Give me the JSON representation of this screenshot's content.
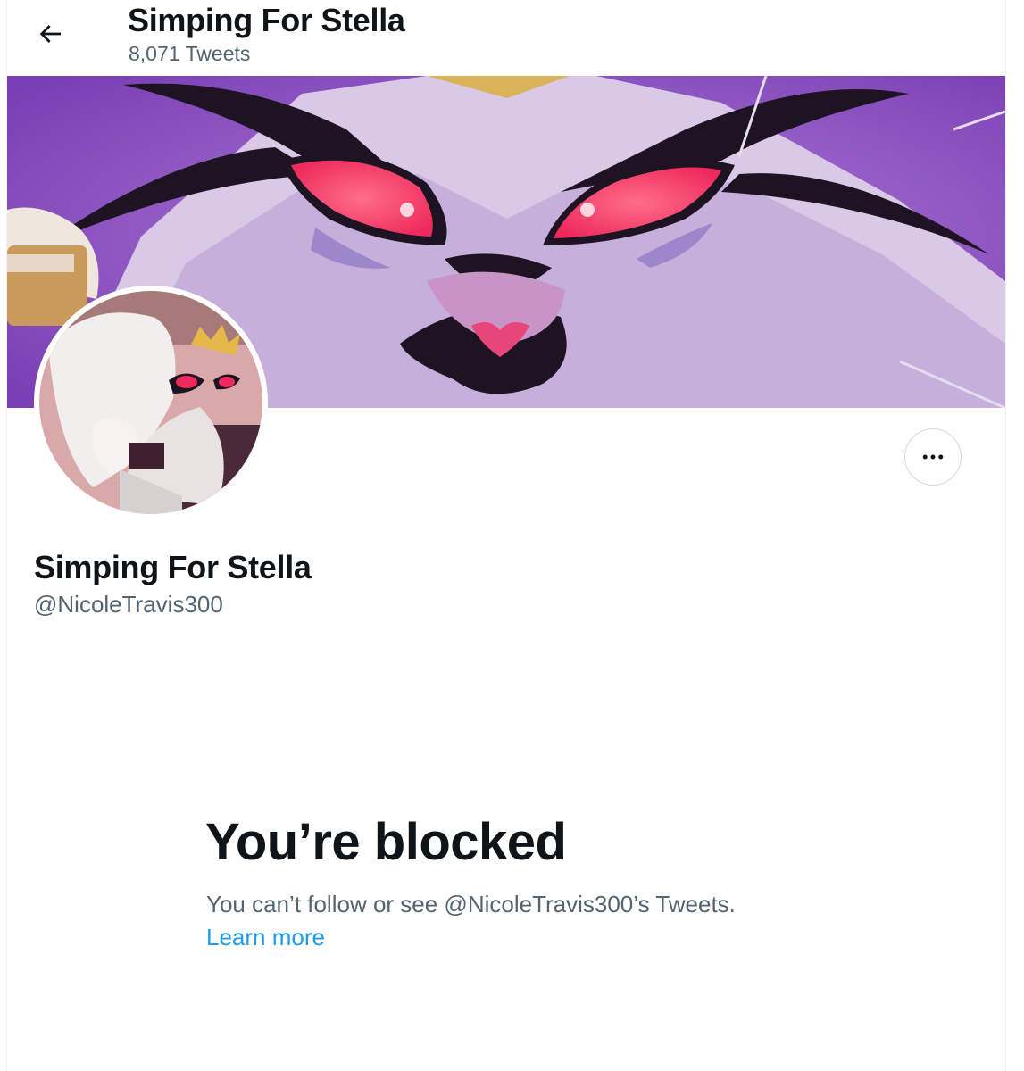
{
  "header": {
    "title": "Simping For Stella",
    "tweet_count": "8,071 Tweets"
  },
  "profile": {
    "name": "Simping For Stella",
    "handle": "@NicoleTravis300"
  },
  "blocked": {
    "title": "You’re blocked",
    "description": "You can’t follow or see @NicoleTravis300’s Tweets.",
    "learn_more": "Learn more"
  },
  "icons": {
    "back": "arrow-left-icon",
    "more": "more-dots-icon"
  },
  "colors": {
    "text_primary": "#0f1419",
    "text_secondary": "#536471",
    "link": "#1d9bf0",
    "banner_purple": "#8b5bbd"
  }
}
